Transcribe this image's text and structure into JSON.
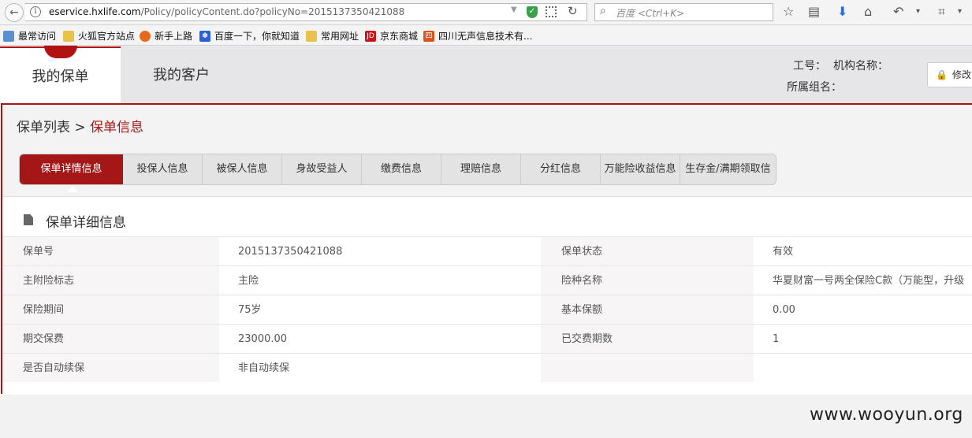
{
  "browser": {
    "url_host": "eservice.hxlife.com",
    "url_path": "/Policy/policyContent.do?policyNo=2015137350421088",
    "search_placeholder": "百度 <Ctrl+K>",
    "bookmarks": [
      "最常访问",
      "火狐官方站点",
      "新手上路",
      "百度一下，你就知道",
      "常用网址",
      "京东商城",
      "四川无声信息技术有..."
    ]
  },
  "header": {
    "tabs": [
      "我的保单",
      "我的客户"
    ],
    "staff_id_label": "工号：",
    "org_label": "机构名称：",
    "group_label": "所属组名：",
    "modify_button": "修改"
  },
  "breadcrumb": {
    "parent": "保单列表",
    "separator": ">",
    "current": "保单信息"
  },
  "subtabs": [
    "保单详情信息",
    "投保人信息",
    "被保人信息",
    "身故受益人",
    "缴费信息",
    "理赔信息",
    "分红信息",
    "万能险收益信息",
    "生存金/满期领取信"
  ],
  "section": {
    "title": "保单详细信息",
    "rows": [
      {
        "l1": "保单号",
        "v1": "2015137350421088",
        "l2": "保单状态",
        "v2": "有效"
      },
      {
        "l1": "主附险标志",
        "v1": "主险",
        "l2": "险种名称",
        "v2": "华夏财富一号两全保险C款（万能型，升级"
      },
      {
        "l1": "保险期间",
        "v1": "75岁",
        "l2": "基本保额",
        "v2": "0.00"
      },
      {
        "l1": "期交保费",
        "v1": "23000.00",
        "l2": "已交费期数",
        "v2": "1"
      },
      {
        "l1": "是否自动续保",
        "v1": "非自动续保",
        "l2": "",
        "v2": ""
      }
    ]
  },
  "watermark": "www.wooyun.org",
  "colors": {
    "brand": "#a51717",
    "header_bg": "#e6e6e9"
  }
}
